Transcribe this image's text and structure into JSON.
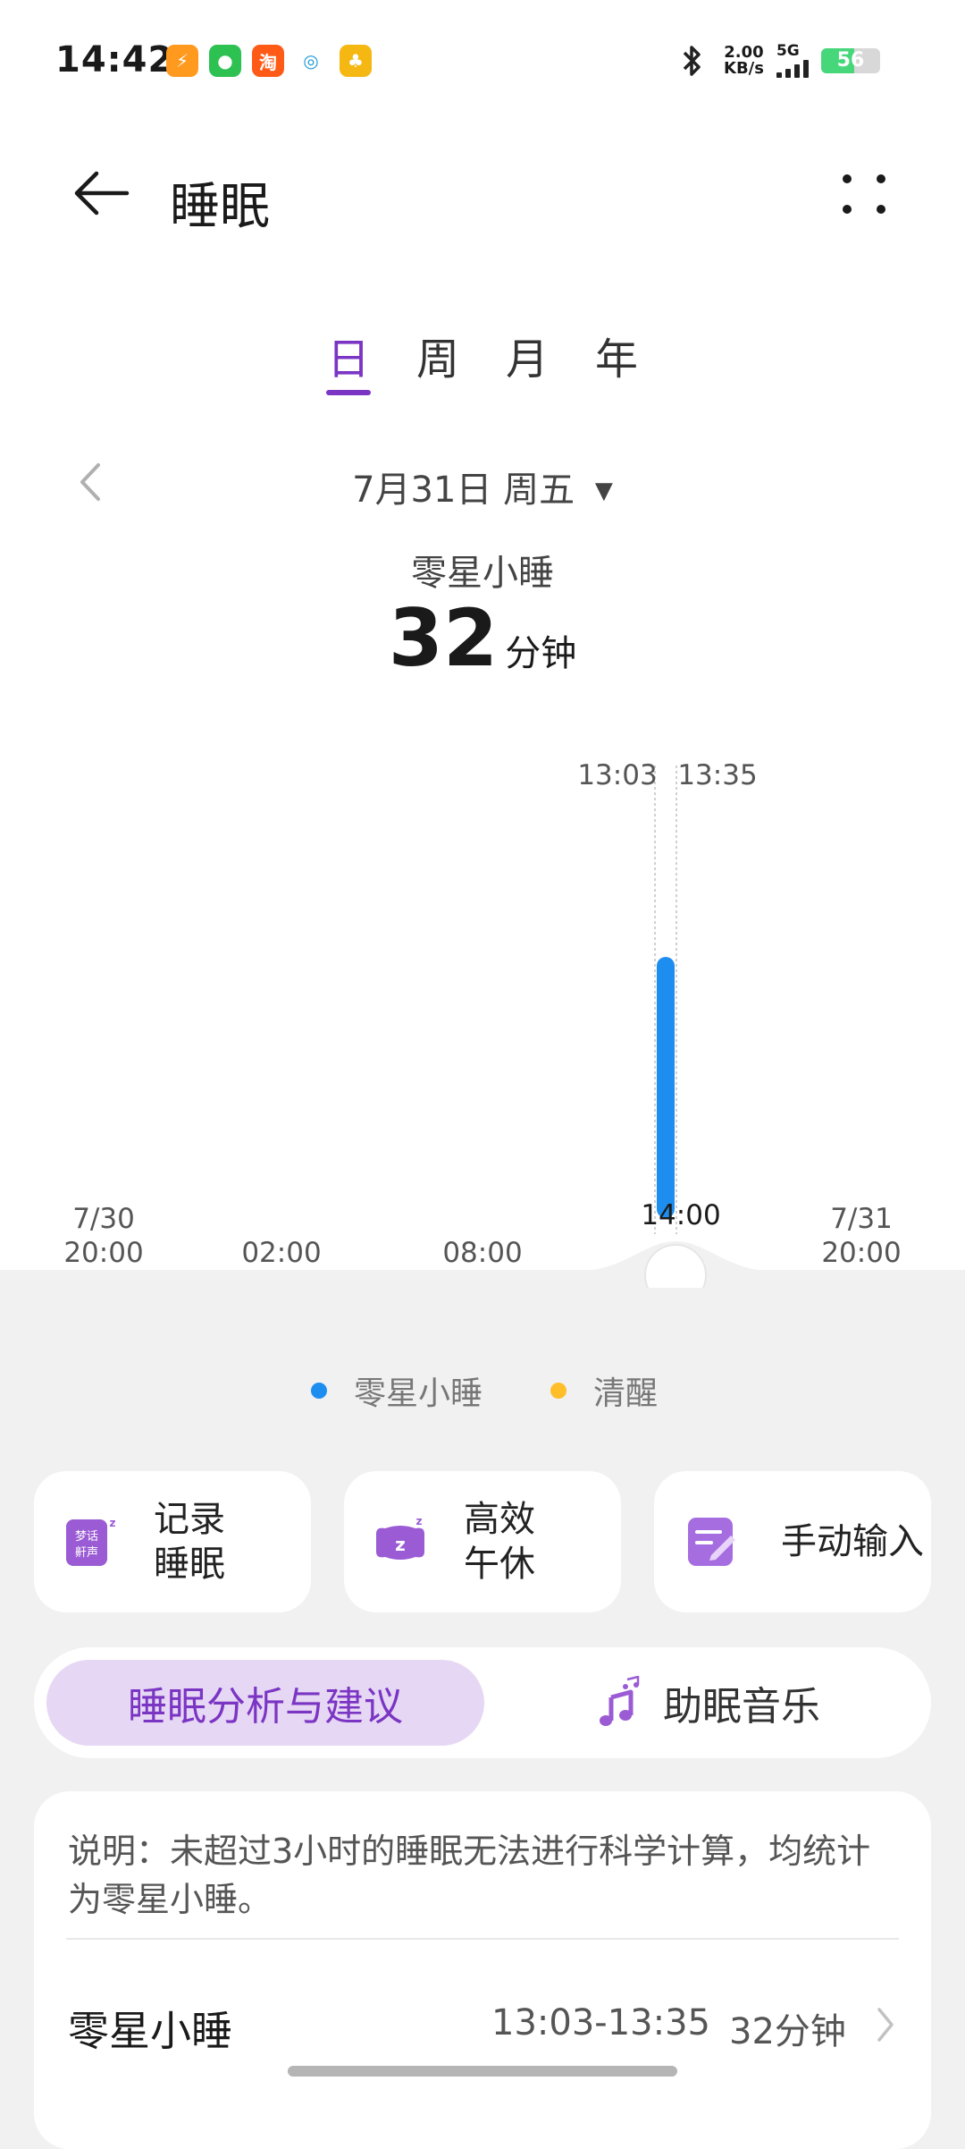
{
  "status_bar": {
    "time": "14:42",
    "apps": [
      {
        "icon": "sports-app-icon",
        "glyph": "⚡",
        "color": "#ff9a1f"
      },
      {
        "icon": "wechat-icon",
        "glyph": "●",
        "color": "#2dc152"
      },
      {
        "icon": "taobao-icon",
        "glyph": "淘",
        "color": "#ff5a16"
      },
      {
        "icon": "china-mobile-icon",
        "glyph": "◎",
        "color": "#1e9ad6"
      },
      {
        "icon": "sprout-app-icon",
        "glyph": "♣",
        "color": "#f5b711"
      }
    ],
    "speed_value": "2.00",
    "speed_unit": "KB/s",
    "network": "5G",
    "battery": "56",
    "battery_level": 0.56
  },
  "header": {
    "title": "睡眠"
  },
  "tabs": [
    {
      "label": "日",
      "active": true
    },
    {
      "label": "周",
      "active": false
    },
    {
      "label": "月",
      "active": false
    },
    {
      "label": "年",
      "active": false
    }
  ],
  "date": {
    "label": "7月31日 周五"
  },
  "summary": {
    "label": "零星小睡",
    "value": "32",
    "unit": "分钟"
  },
  "chart_data": {
    "type": "bar",
    "x_labels": [
      "7/30\n20:00",
      "02:00",
      "08:00",
      "14:00",
      "7/31\n20:00"
    ],
    "segments": [
      {
        "stage": "零星小睡",
        "start": "13:03",
        "end": "13:35"
      }
    ],
    "marker_labels": [
      "13:03",
      "13:35"
    ],
    "legend": [
      {
        "name": "零星小睡",
        "color": "#1d8ef0"
      },
      {
        "name": "清醒",
        "color": "#ffbe2a"
      }
    ]
  },
  "cards": [
    {
      "label_line1": "记录",
      "label_line2": "睡眠",
      "icon": "dream-talk-icon",
      "icon_text": "梦话鼾声"
    },
    {
      "label_line1": "高效",
      "label_line2": "午休",
      "icon": "nap-pillow-icon"
    },
    {
      "label": "手动输入",
      "icon": "manual-entry-icon"
    }
  ],
  "segment_tabs": {
    "analysis": "睡眠分析与建议",
    "music": "助眠音乐"
  },
  "info": {
    "note": "说明：未超过3小时的睡眠无法进行科学计算，均统计为零星小睡。",
    "row_title": "零星小睡",
    "row_time": "13:03-13:35",
    "row_duration": "32分钟"
  },
  "colors": {
    "accent": "#7b35c3",
    "sleep_bar": "#1d8ef0"
  }
}
